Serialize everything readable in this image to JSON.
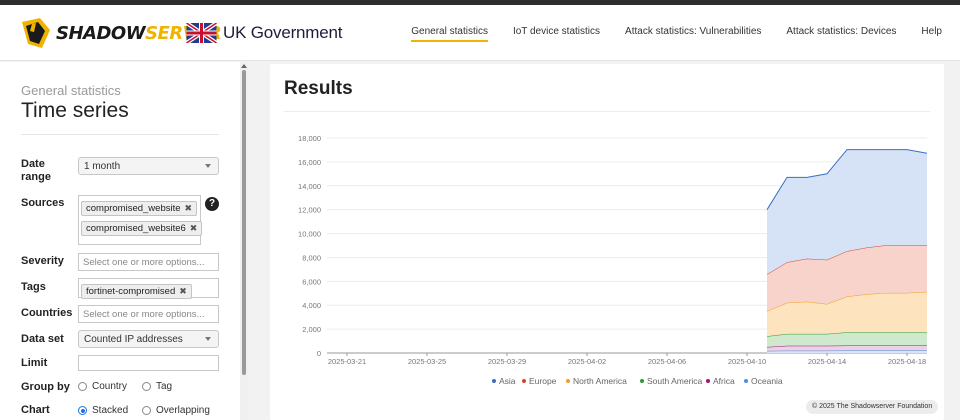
{
  "header": {
    "brand_part1": "SHADOW",
    "brand_part2": "SERVER",
    "gov_label": "UK Government",
    "nav": [
      {
        "label": "General statistics",
        "active": true
      },
      {
        "label": "IoT device statistics",
        "active": false
      },
      {
        "label": "Attack statistics: Vulnerabilities",
        "active": false
      },
      {
        "label": "Attack statistics: Devices",
        "active": false
      },
      {
        "label": "Help",
        "active": false
      }
    ]
  },
  "sidebar": {
    "subtitle": "General statistics",
    "title": "Time series",
    "date_range": {
      "label": "Date range",
      "value": "1 month"
    },
    "sources": {
      "label": "Sources",
      "tags": [
        "compromised_website",
        "compromised_website6"
      ],
      "help": "?"
    },
    "severity": {
      "label": "Severity",
      "placeholder": "Select one or more options..."
    },
    "tags": {
      "label": "Tags",
      "tags": [
        "fortinet-compromised"
      ]
    },
    "countries": {
      "label": "Countries",
      "placeholder": "Select one or more options..."
    },
    "data_set": {
      "label": "Data set",
      "value": "Counted IP addresses"
    },
    "limit": {
      "label": "Limit",
      "value": ""
    },
    "group_by": {
      "label": "Group by",
      "options": [
        "Country",
        "Tag"
      ],
      "selected": ""
    },
    "chart": {
      "label": "Chart",
      "options": [
        "Stacked",
        "Overlapping"
      ],
      "selected": "Stacked"
    }
  },
  "results": {
    "title": "Results",
    "footer": "© 2025 The Shadowserver Foundation"
  },
  "chart_data": {
    "type": "area",
    "stacked": true,
    "x": [
      "2025-04-11",
      "2025-04-12",
      "2025-04-13",
      "2025-04-14",
      "2025-04-15",
      "2025-04-16",
      "2025-04-17",
      "2025-04-18",
      "2025-04-19"
    ],
    "x_range": [
      "2025-03-20",
      "2025-04-19"
    ],
    "x_tick_labels": [
      "2025-03-21",
      "2025-03-25",
      "2025-03-29",
      "2025-04-02",
      "2025-04-06",
      "2025-04-10",
      "2025-04-14",
      "2025-04-18"
    ],
    "y_ticks": [
      0,
      2000,
      4000,
      6000,
      8000,
      10000,
      12000,
      14000,
      16000,
      18000
    ],
    "y_tick_labels": [
      "0",
      "2,000",
      "4,000",
      "6,000",
      "8,000",
      "10,000",
      "12,000",
      "14,000",
      "16,000",
      "18,000"
    ],
    "ylim": [
      0,
      18000
    ],
    "series": [
      {
        "name": "Oceania",
        "color": "#4a90e2",
        "fill": "#d6e6f8",
        "values": [
          180,
          200,
          200,
          200,
          210,
          210,
          210,
          210,
          210
        ]
      },
      {
        "name": "Africa",
        "color": "#a0147a",
        "fill": "#ecd0e3",
        "values": [
          320,
          400,
          400,
          400,
          420,
          420,
          420,
          420,
          420
        ]
      },
      {
        "name": "South America",
        "color": "#2e9b2e",
        "fill": "#cfe9cf",
        "values": [
          900,
          1000,
          1000,
          1000,
          1100,
          1100,
          1100,
          1100,
          1100
        ]
      },
      {
        "name": "North America",
        "color": "#f0a020",
        "fill": "#fde4bf",
        "values": [
          2100,
          2600,
          2700,
          2500,
          3000,
          3200,
          3300,
          3300,
          3400
        ]
      },
      {
        "name": "Europe",
        "color": "#d04a2a",
        "fill": "#f7d3cc",
        "values": [
          3100,
          3400,
          3600,
          3700,
          3800,
          3900,
          4000,
          4000,
          3900
        ]
      },
      {
        "name": "Asia",
        "color": "#3a6fc0",
        "fill": "#d6e3f7",
        "values": [
          5400,
          7100,
          6800,
          7200,
          8500,
          8200,
          8000,
          8000,
          7700
        ]
      }
    ],
    "legend": [
      "Asia",
      "Europe",
      "North America",
      "South America",
      "Africa",
      "Oceania"
    ],
    "legend_position": "bottom"
  }
}
